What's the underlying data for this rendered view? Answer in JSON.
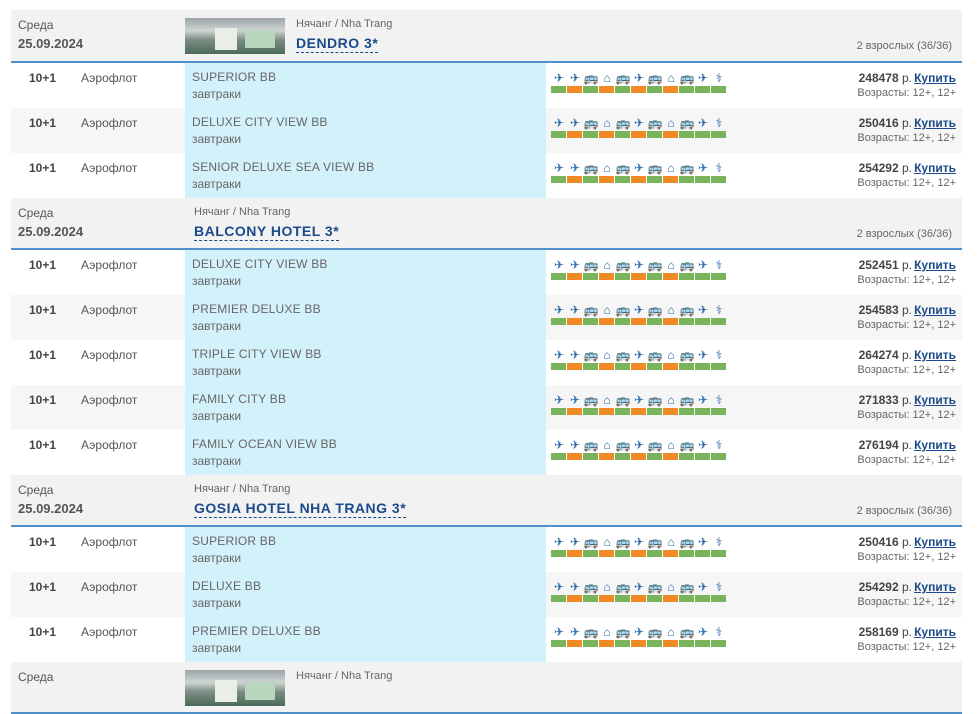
{
  "blocks": [
    {
      "day": "Среда",
      "date": "25.09.2024",
      "has_thumb": true,
      "city": "Нячанг / Nha Trang",
      "hotel": "DENDRO 3*",
      "adults": "2 взрослых (36/36)",
      "offers": [
        {
          "nights": "10+1",
          "airline": "Аэрофлот",
          "room": "SUPERIOR BB",
          "meal": "завтраки",
          "price": "248478",
          "cur": "р.",
          "buy": "Купить",
          "ages": "Возрасты: 12+, 12+"
        },
        {
          "nights": "10+1",
          "airline": "Аэрофлот",
          "room": "DELUXE CITY VIEW BB",
          "meal": "завтраки",
          "price": "250416",
          "cur": "р.",
          "buy": "Купить",
          "ages": "Возрасты: 12+, 12+"
        },
        {
          "nights": "10+1",
          "airline": "Аэрофлот",
          "room": "SENIOR DELUXE SEA VIEW BB",
          "meal": "завтраки",
          "price": "254292",
          "cur": "р.",
          "buy": "Купить",
          "ages": "Возрасты: 12+, 12+"
        }
      ]
    },
    {
      "day": "Среда",
      "date": "25.09.2024",
      "has_thumb": false,
      "city": "Нячанг / Nha Trang",
      "hotel": "BALCONY HOTEL 3*",
      "adults": "2 взрослых (36/36)",
      "offers": [
        {
          "nights": "10+1",
          "airline": "Аэрофлот",
          "room": "DELUXE CITY VIEW BB",
          "meal": "завтраки",
          "price": "252451",
          "cur": "р.",
          "buy": "Купить",
          "ages": "Возрасты: 12+, 12+"
        },
        {
          "nights": "10+1",
          "airline": "Аэрофлот",
          "room": "PREMIER DELUXE BB",
          "meal": "завтраки",
          "price": "254583",
          "cur": "р.",
          "buy": "Купить",
          "ages": "Возрасты: 12+, 12+"
        },
        {
          "nights": "10+1",
          "airline": "Аэрофлот",
          "room": "TRIPLE CITY VIEW BB",
          "meal": "завтраки",
          "price": "264274",
          "cur": "р.",
          "buy": "Купить",
          "ages": "Возрасты: 12+, 12+"
        },
        {
          "nights": "10+1",
          "airline": "Аэрофлот",
          "room": "FAMILY CITY BB",
          "meal": "завтраки",
          "price": "271833",
          "cur": "р.",
          "buy": "Купить",
          "ages": "Возрасты: 12+, 12+"
        },
        {
          "nights": "10+1",
          "airline": "Аэрофлот",
          "room": "FAMILY OCEAN VIEW BB",
          "meal": "завтраки",
          "price": "276194",
          "cur": "р.",
          "buy": "Купить",
          "ages": "Возрасты: 12+, 12+"
        }
      ]
    },
    {
      "day": "Среда",
      "date": "25.09.2024",
      "has_thumb": false,
      "city": "Нячанг / Nha Trang",
      "hotel": "GOSIA HOTEL NHA TRANG 3*",
      "adults": "2 взрослых (36/36)",
      "offers": [
        {
          "nights": "10+1",
          "airline": "Аэрофлот",
          "room": "SUPERIOR BB",
          "meal": "завтраки",
          "price": "250416",
          "cur": "р.",
          "buy": "Купить",
          "ages": "Возрасты: 12+, 12+"
        },
        {
          "nights": "10+1",
          "airline": "Аэрофлот",
          "room": "DELUXE BB",
          "meal": "завтраки",
          "price": "254292",
          "cur": "р.",
          "buy": "Купить",
          "ages": "Возрасты: 12+, 12+"
        },
        {
          "nights": "10+1",
          "airline": "Аэрофлот",
          "room": "PREMIER DELUXE BB",
          "meal": "завтраки",
          "price": "258169",
          "cur": "р.",
          "buy": "Купить",
          "ages": "Возрасты: 12+, 12+"
        }
      ]
    },
    {
      "day": "Среда",
      "date": "",
      "has_thumb": true,
      "city": "Нячанг / Nha Trang",
      "hotel": "",
      "adults": "",
      "offers": []
    }
  ],
  "service_icons": [
    {
      "icon": "plane-icon",
      "glyph": "✈",
      "status": "green"
    },
    {
      "icon": "plane-icon",
      "glyph": "✈",
      "status": "orange"
    },
    {
      "icon": "bus-icon",
      "glyph": "🚌",
      "status": "green"
    },
    {
      "icon": "hotel-icon",
      "glyph": "⌂",
      "status": "orange"
    },
    {
      "icon": "bus-icon",
      "glyph": "🚌",
      "status": "green"
    },
    {
      "icon": "plane-icon",
      "glyph": "✈",
      "status": "orange"
    },
    {
      "icon": "bus-icon",
      "glyph": "🚌",
      "status": "green"
    },
    {
      "icon": "hotel-icon",
      "glyph": "⌂",
      "status": "orange"
    },
    {
      "icon": "bus-icon",
      "glyph": "🚌",
      "status": "green"
    },
    {
      "icon": "plane-icon",
      "glyph": "✈",
      "status": "green"
    },
    {
      "icon": "insurance-icon",
      "glyph": "⚕",
      "status": "green"
    }
  ],
  "colors": {
    "header_bg": "#f2f2f2",
    "header_border": "#4f8fca",
    "room_bg": "#d3f1fb",
    "link": "#1a4a8a",
    "status_green": "#7bb35c",
    "status_orange": "#f08a27",
    "icon_blue": "#2d6aa8"
  }
}
